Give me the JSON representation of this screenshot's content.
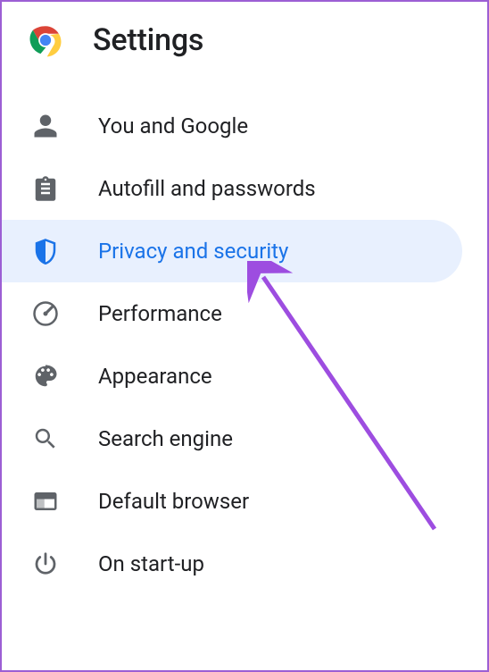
{
  "header": {
    "title": "Settings"
  },
  "nav": {
    "items": [
      {
        "label": "You and Google",
        "selected": false
      },
      {
        "label": "Autofill and passwords",
        "selected": false
      },
      {
        "label": "Privacy and security",
        "selected": true
      },
      {
        "label": "Performance",
        "selected": false
      },
      {
        "label": "Appearance",
        "selected": false
      },
      {
        "label": "Search engine",
        "selected": false
      },
      {
        "label": "Default browser",
        "selected": false
      },
      {
        "label": "On start-up",
        "selected": false
      }
    ]
  }
}
